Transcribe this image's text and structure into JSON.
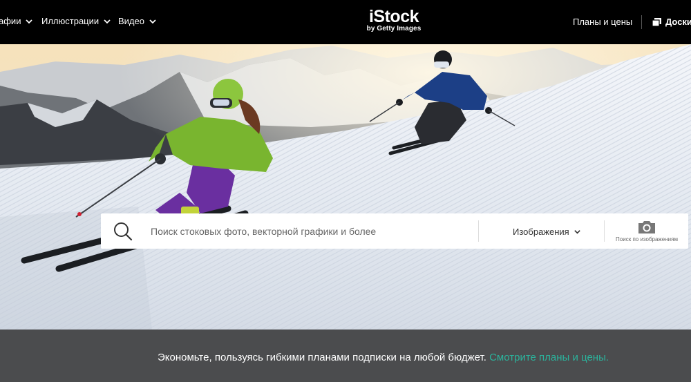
{
  "nav": {
    "photos": "афии",
    "illustrations": "Иллюстрации",
    "video": "Видео",
    "plans": "Планы и цены",
    "boards": "Доски"
  },
  "logo": {
    "brand": "iStock",
    "tagline": "by Getty Images"
  },
  "search": {
    "placeholder": "Поиск стоковых фото, векторной графики и более",
    "type": "Изображения",
    "visual_search_label": "Поиск по изображениям"
  },
  "promo": {
    "text": "Экономьте, пользуясь гибкими планами подписки на любой бюджет.",
    "link": "Смотрите планы и цены."
  },
  "colors": {
    "link": "#2bb39c",
    "topbar": "#000000",
    "promo_band": "#4b4c4e"
  },
  "icons": [
    "chevron-down-icon",
    "boards-icon",
    "search-icon",
    "camera-icon"
  ]
}
